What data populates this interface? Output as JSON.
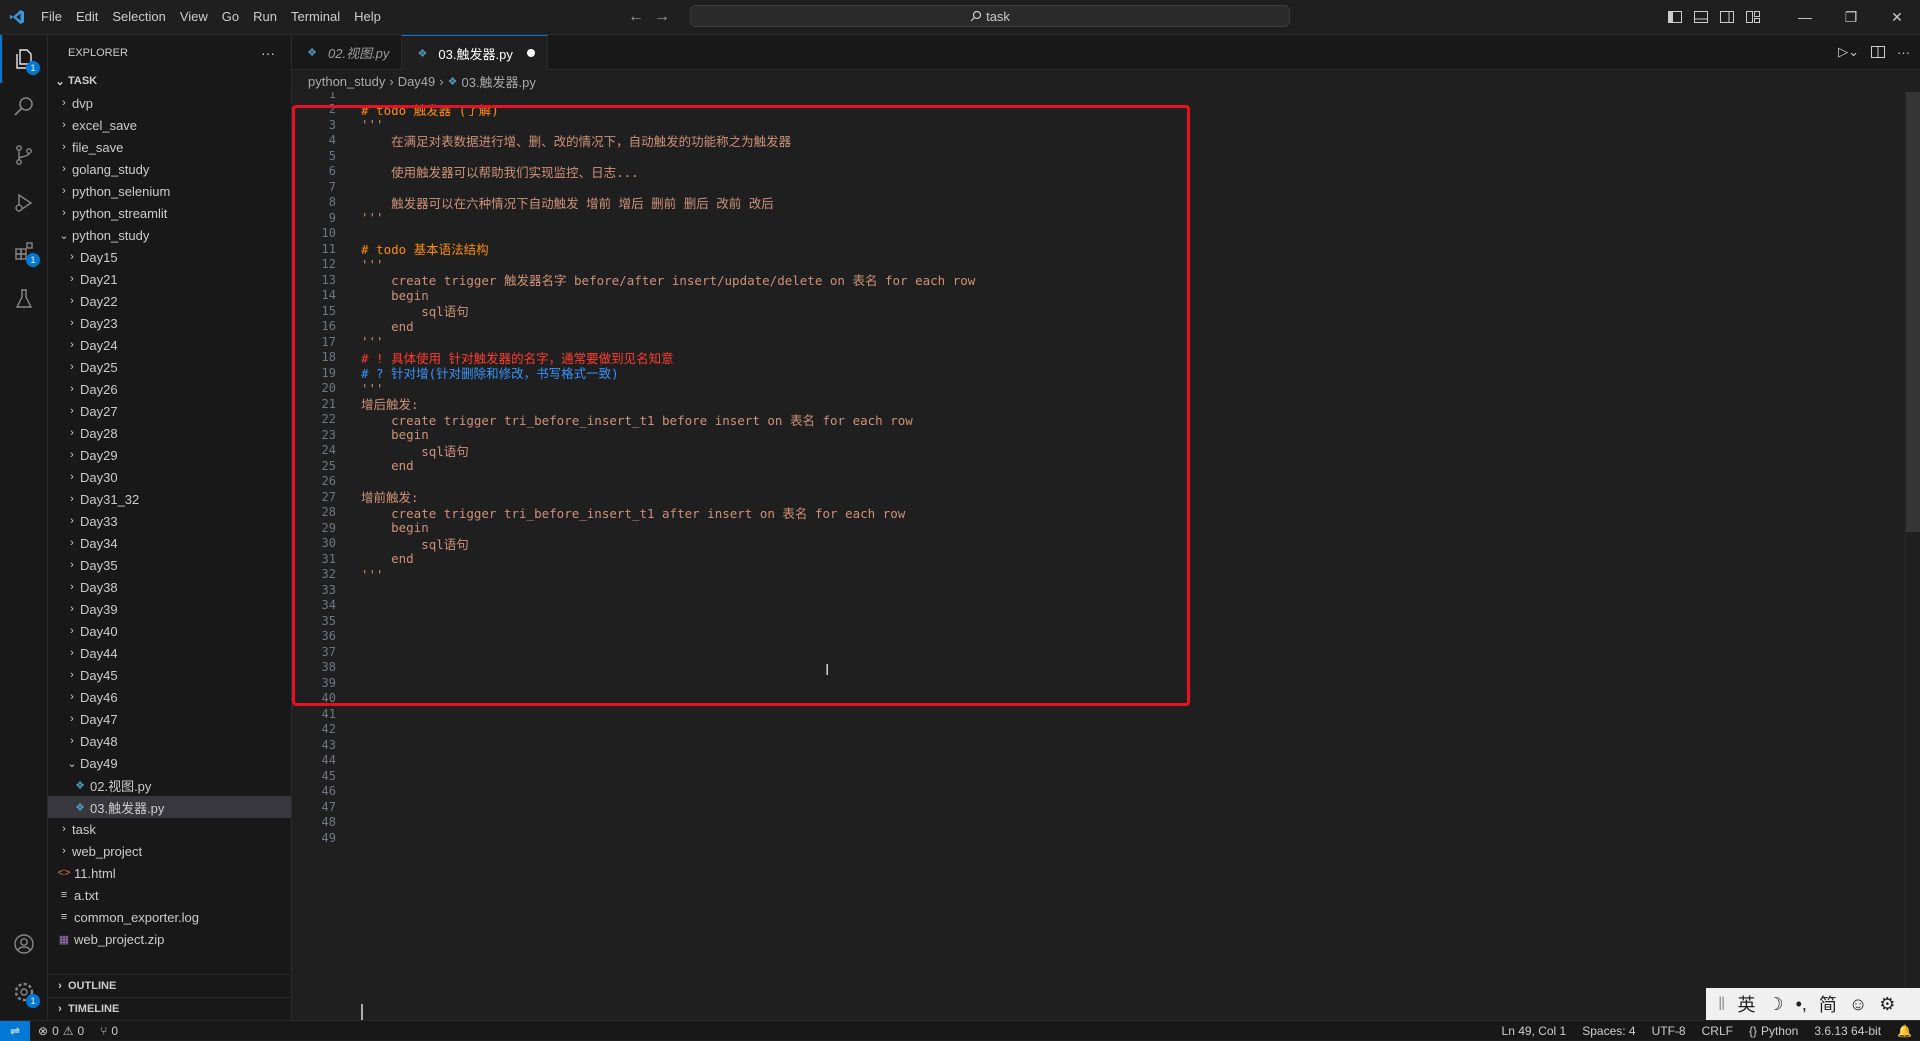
{
  "titlebar": {
    "menu": [
      "File",
      "Edit",
      "Selection",
      "View",
      "Go",
      "Run",
      "Terminal",
      "Help"
    ],
    "search_text": "task"
  },
  "activity_bar": {
    "explorer_badge": "1",
    "extensions_badge": "1",
    "settings_badge": "1"
  },
  "explorer": {
    "title": "EXPLORER",
    "more": "···",
    "root": "TASK",
    "tree": [
      {
        "label": "dvp",
        "indent": 1,
        "kind": "folder",
        "state": "collapsed"
      },
      {
        "label": "excel_save",
        "indent": 1,
        "kind": "folder",
        "state": "collapsed"
      },
      {
        "label": "file_save",
        "indent": 1,
        "kind": "folder",
        "state": "collapsed"
      },
      {
        "label": "golang_study",
        "indent": 1,
        "kind": "folder",
        "state": "collapsed"
      },
      {
        "label": "python_selenium",
        "indent": 1,
        "kind": "folder",
        "state": "collapsed"
      },
      {
        "label": "python_streamlit",
        "indent": 1,
        "kind": "folder",
        "state": "collapsed"
      },
      {
        "label": "python_study",
        "indent": 1,
        "kind": "folder",
        "state": "expanded"
      },
      {
        "label": "Day15",
        "indent": 2,
        "kind": "folder",
        "state": "collapsed"
      },
      {
        "label": "Day21",
        "indent": 2,
        "kind": "folder",
        "state": "collapsed"
      },
      {
        "label": "Day22",
        "indent": 2,
        "kind": "folder",
        "state": "collapsed"
      },
      {
        "label": "Day23",
        "indent": 2,
        "kind": "folder",
        "state": "collapsed"
      },
      {
        "label": "Day24",
        "indent": 2,
        "kind": "folder",
        "state": "collapsed"
      },
      {
        "label": "Day25",
        "indent": 2,
        "kind": "folder",
        "state": "collapsed"
      },
      {
        "label": "Day26",
        "indent": 2,
        "kind": "folder",
        "state": "collapsed"
      },
      {
        "label": "Day27",
        "indent": 2,
        "kind": "folder",
        "state": "collapsed"
      },
      {
        "label": "Day28",
        "indent": 2,
        "kind": "folder",
        "state": "collapsed"
      },
      {
        "label": "Day29",
        "indent": 2,
        "kind": "folder",
        "state": "collapsed"
      },
      {
        "label": "Day30",
        "indent": 2,
        "kind": "folder",
        "state": "collapsed"
      },
      {
        "label": "Day31_32",
        "indent": 2,
        "kind": "folder",
        "state": "collapsed"
      },
      {
        "label": "Day33",
        "indent": 2,
        "kind": "folder",
        "state": "collapsed"
      },
      {
        "label": "Day34",
        "indent": 2,
        "kind": "folder",
        "state": "collapsed"
      },
      {
        "label": "Day35",
        "indent": 2,
        "kind": "folder",
        "state": "collapsed"
      },
      {
        "label": "Day38",
        "indent": 2,
        "kind": "folder",
        "state": "collapsed"
      },
      {
        "label": "Day39",
        "indent": 2,
        "kind": "folder",
        "state": "collapsed"
      },
      {
        "label": "Day40",
        "indent": 2,
        "kind": "folder",
        "state": "collapsed"
      },
      {
        "label": "Day44",
        "indent": 2,
        "kind": "folder",
        "state": "collapsed"
      },
      {
        "label": "Day45",
        "indent": 2,
        "kind": "folder",
        "state": "collapsed"
      },
      {
        "label": "Day46",
        "indent": 2,
        "kind": "folder",
        "state": "collapsed"
      },
      {
        "label": "Day47",
        "indent": 2,
        "kind": "folder",
        "state": "collapsed"
      },
      {
        "label": "Day48",
        "indent": 2,
        "kind": "folder",
        "state": "collapsed"
      },
      {
        "label": "Day49",
        "indent": 2,
        "kind": "folder",
        "state": "expanded"
      },
      {
        "label": "02.视图.py",
        "indent": 3,
        "kind": "python",
        "state": "file"
      },
      {
        "label": "03.触发器.py",
        "indent": 3,
        "kind": "python",
        "state": "file",
        "selected": true
      },
      {
        "label": "task",
        "indent": 1,
        "kind": "folder",
        "state": "collapsed"
      },
      {
        "label": "web_project",
        "indent": 1,
        "kind": "folder",
        "state": "collapsed"
      },
      {
        "label": "11.html",
        "indent": 1,
        "kind": "html",
        "state": "file"
      },
      {
        "label": "a.txt",
        "indent": 1,
        "kind": "txt",
        "state": "file"
      },
      {
        "label": "common_exporter.log",
        "indent": 1,
        "kind": "log",
        "state": "file"
      },
      {
        "label": "web_project.zip",
        "indent": 1,
        "kind": "zip",
        "state": "file"
      }
    ],
    "outline": "OUTLINE",
    "timeline": "TIMELINE"
  },
  "tabs": [
    {
      "label": "02.视图.py",
      "active": false,
      "preview": true
    },
    {
      "label": "03.触发器.py",
      "active": true,
      "dirty": true
    }
  ],
  "breadcrumb": [
    "python_study",
    "Day49",
    "03.触发器.py"
  ],
  "code_lines": [
    {
      "n": "1",
      "t": "",
      "c": "c-orange"
    },
    {
      "n": "2",
      "t": "# todo 触发器 (了解)",
      "c": "c-todo"
    },
    {
      "n": "3",
      "t": "'''",
      "c": "c-orange"
    },
    {
      "n": "4",
      "t": "    在满足对表数据进行增、删、改的情况下，自动触发的功能称之为触发器",
      "c": "c-orange"
    },
    {
      "n": "5",
      "t": "",
      "c": "c-orange"
    },
    {
      "n": "6",
      "t": "    使用触发器可以帮助我们实现监控、日志...",
      "c": "c-orange"
    },
    {
      "n": "7",
      "t": "",
      "c": "c-orange"
    },
    {
      "n": "8",
      "t": "    触发器可以在六种情况下自动触发 增前 增后 删前 删后 改前 改后",
      "c": "c-orange"
    },
    {
      "n": "9",
      "t": "'''",
      "c": "c-orange"
    },
    {
      "n": "10",
      "t": "",
      "c": "c-orange"
    },
    {
      "n": "11",
      "t": "# todo 基本语法结构",
      "c": "c-todo"
    },
    {
      "n": "12",
      "t": "'''",
      "c": "c-orange"
    },
    {
      "n": "13",
      "t": "    create trigger 触发器名字 before/after insert/update/delete on 表名 for each row",
      "c": "c-orange"
    },
    {
      "n": "14",
      "t": "    begin",
      "c": "c-orange"
    },
    {
      "n": "15",
      "t": "        sql语句",
      "c": "c-orange"
    },
    {
      "n": "16",
      "t": "    end",
      "c": "c-orange"
    },
    {
      "n": "17",
      "t": "'''",
      "c": "c-orange"
    },
    {
      "n": "18",
      "t": "# ! 具体使用 针对触发器的名字，通常要做到见名知意",
      "c": "c-red"
    },
    {
      "n": "19",
      "t": "# ? 针对增(针对删除和修改，书写格式一致)",
      "c": "c-blue"
    },
    {
      "n": "20",
      "t": "'''",
      "c": "c-orange"
    },
    {
      "n": "21",
      "t": "增后触发:",
      "c": "c-orange"
    },
    {
      "n": "22",
      "t": "    create trigger tri_before_insert_t1 before insert on 表名 for each row",
      "c": "c-orange"
    },
    {
      "n": "23",
      "t": "    begin",
      "c": "c-orange"
    },
    {
      "n": "24",
      "t": "        sql语句",
      "c": "c-orange"
    },
    {
      "n": "25",
      "t": "    end",
      "c": "c-orange"
    },
    {
      "n": "26",
      "t": "",
      "c": "c-orange"
    },
    {
      "n": "27",
      "t": "增前触发:",
      "c": "c-orange"
    },
    {
      "n": "28",
      "t": "    create trigger tri_before_insert_t1 after insert on 表名 for each row",
      "c": "c-orange"
    },
    {
      "n": "29",
      "t": "    begin",
      "c": "c-orange"
    },
    {
      "n": "30",
      "t": "        sql语句",
      "c": "c-orange"
    },
    {
      "n": "31",
      "t": "    end",
      "c": "c-orange"
    },
    {
      "n": "32",
      "t": "'''",
      "c": "c-orange"
    },
    {
      "n": "33",
      "t": "",
      "c": "c-orange"
    },
    {
      "n": "34",
      "t": "",
      "c": "c-orange"
    },
    {
      "n": "35",
      "t": "",
      "c": "c-orange"
    },
    {
      "n": "36",
      "t": "",
      "c": "c-orange"
    },
    {
      "n": "37",
      "t": "",
      "c": "c-orange"
    },
    {
      "n": "38",
      "t": "",
      "c": "c-orange"
    },
    {
      "n": "39",
      "t": "",
      "c": "c-orange"
    },
    {
      "n": "40",
      "t": "",
      "c": "c-orange"
    },
    {
      "n": "41",
      "t": "",
      "c": "c-orange"
    },
    {
      "n": "42",
      "t": "",
      "c": "c-orange"
    },
    {
      "n": "43",
      "t": "",
      "c": "c-orange"
    },
    {
      "n": "44",
      "t": "",
      "c": "c-orange"
    },
    {
      "n": "45",
      "t": "",
      "c": "c-orange"
    },
    {
      "n": "46",
      "t": "",
      "c": "c-orange"
    },
    {
      "n": "47",
      "t": "",
      "c": "c-orange"
    },
    {
      "n": "48",
      "t": "",
      "c": "c-orange"
    },
    {
      "n": "49",
      "t": "",
      "c": "c-orange"
    }
  ],
  "ime": [
    "英",
    "☽",
    "•,",
    "简",
    "☺",
    "⚙"
  ],
  "statusbar": {
    "errors": "0",
    "warnings": "0",
    "ports": "0",
    "position": "Ln 49, Col 1",
    "spaces": "Spaces: 4",
    "encoding": "UTF-8",
    "eol": "CRLF",
    "language": "Python",
    "interpreter": "3.6.13 64-bit"
  },
  "colors": {
    "accent": "#0078d4",
    "highlight_box": "#e81123",
    "string": "#ce9178",
    "todo": "#ff8c00",
    "alert": "#ff3b30",
    "question": "#3794ff"
  }
}
